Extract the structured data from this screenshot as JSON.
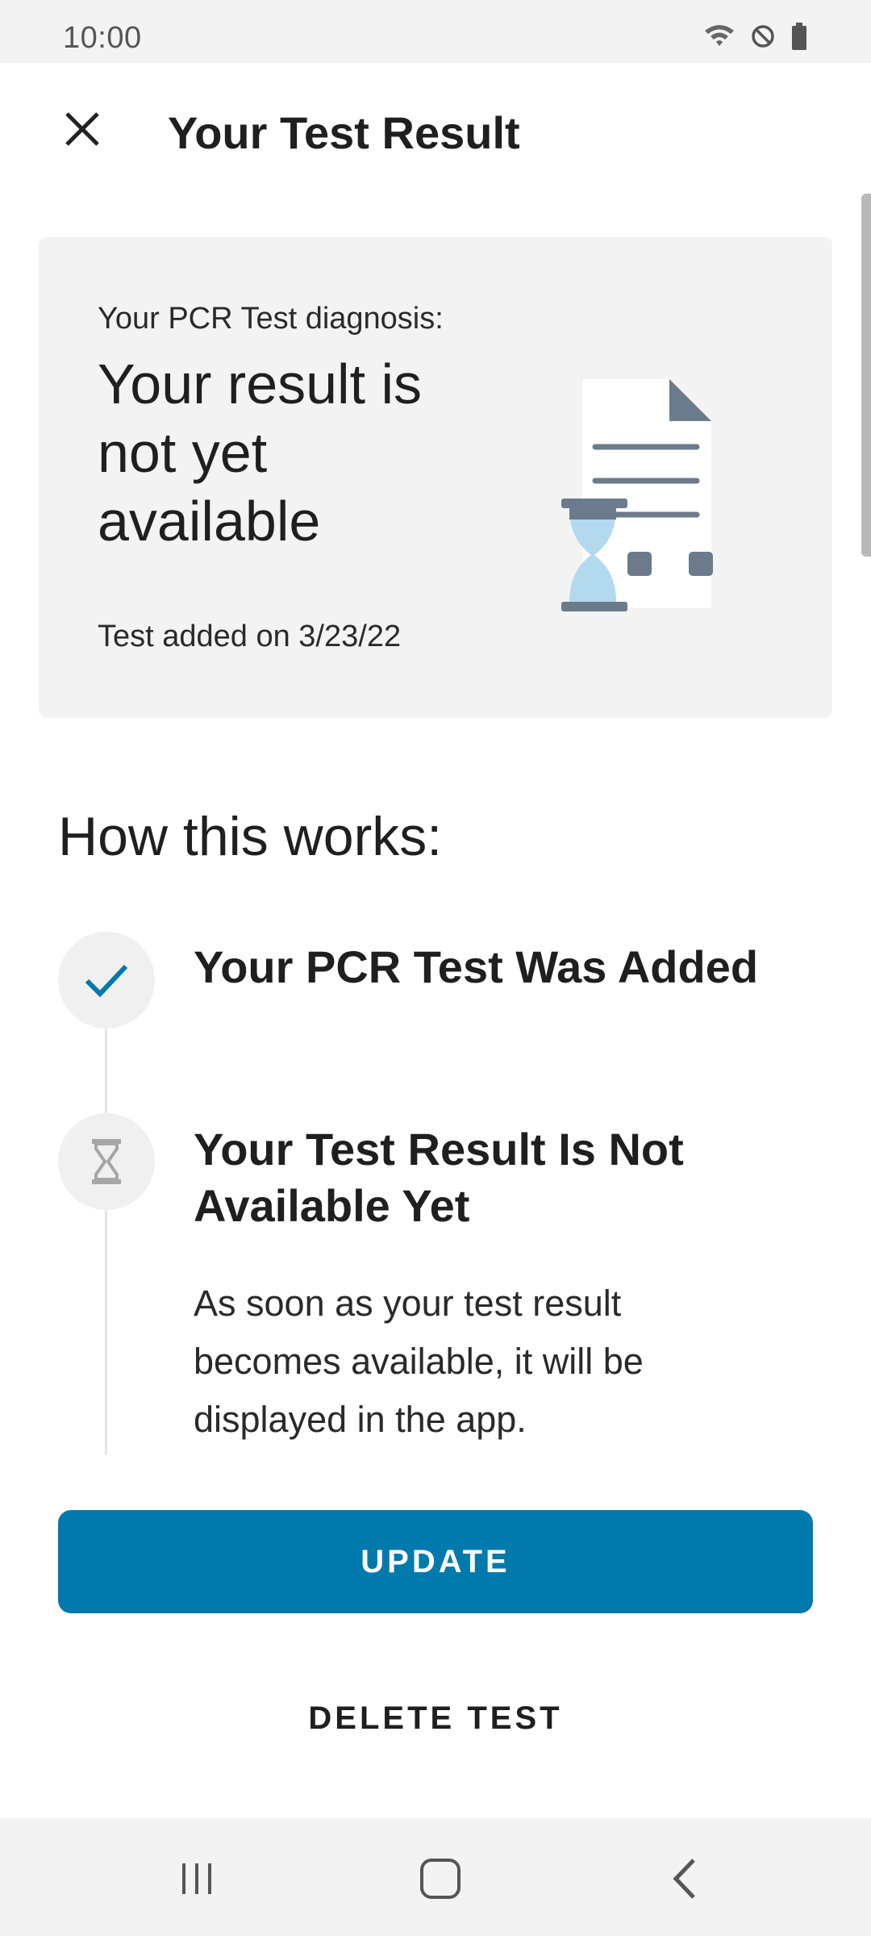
{
  "status_bar": {
    "time": "10:00",
    "icons": [
      "wifi-icon",
      "do-not-disturb-icon",
      "battery-icon"
    ]
  },
  "app_bar": {
    "title": "Your Test Result",
    "close_icon": "close-icon"
  },
  "result_card": {
    "label": "Your PCR Test diagnosis:",
    "value": "Your result is not yet available",
    "added": "Test added on 3/23/22",
    "illustration": "document-hourglass-illustration"
  },
  "how_it_works": {
    "title": "How this works:",
    "steps": [
      {
        "title": "Your PCR Test Was Added",
        "icon": "check-icon"
      },
      {
        "title": "Your Test Result Is Not Available Yet",
        "icon": "hourglass-icon",
        "description": "As soon as your test result becomes available, it will be displayed in the app."
      }
    ]
  },
  "actions": {
    "update_label": "UPDATE",
    "delete_label": "DELETE TEST"
  },
  "nav_bar": {
    "icons": [
      "recents-icon",
      "home-icon",
      "back-icon"
    ]
  },
  "colors": {
    "accent": "#0079ac",
    "card_bg": "#f3f3f3",
    "illustration_dark": "#6b7b8c",
    "illustration_light": "#b3d9ef"
  }
}
